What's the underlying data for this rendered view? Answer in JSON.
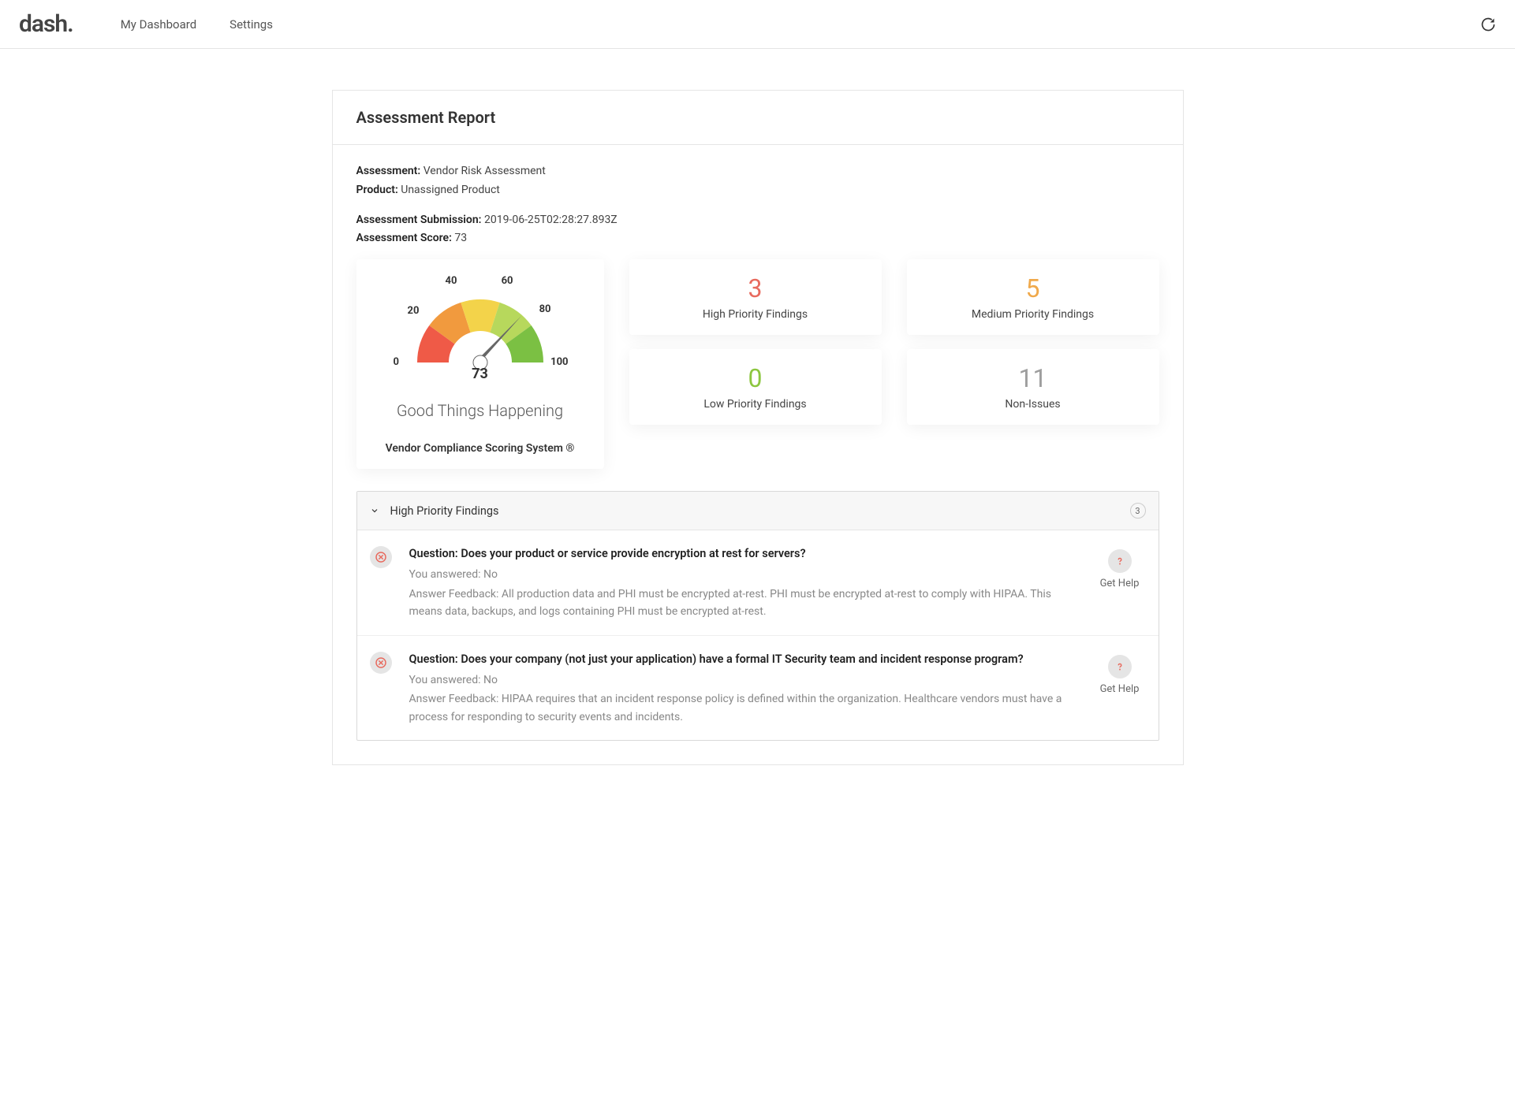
{
  "nav": {
    "logo": "dash",
    "items": [
      "My Dashboard",
      "Settings"
    ]
  },
  "report": {
    "title": "Assessment Report",
    "meta": {
      "assessment_label": "Assessment:",
      "assessment_value": "Vendor Risk Assessment",
      "product_label": "Product:",
      "product_value": "Unassigned Product",
      "submission_label": "Assessment Submission:",
      "submission_value": "2019-06-25T02:28:27.893Z",
      "score_label": "Assessment Score:",
      "score_value": "73"
    },
    "gauge": {
      "score": "73",
      "ticks": [
        "0",
        "20",
        "40",
        "60",
        "80",
        "100"
      ],
      "message": "Good Things Happening",
      "system": "Vendor Compliance Scoring System ®"
    },
    "stats": {
      "high": {
        "value": "3",
        "label": "High Priority Findings"
      },
      "medium": {
        "value": "5",
        "label": "Medium Priority Findings"
      },
      "low": {
        "value": "0",
        "label": "Low Priority Findings"
      },
      "non": {
        "value": "11",
        "label": "Non-Issues"
      }
    },
    "findings_section": {
      "title": "High Priority Findings",
      "count": "3",
      "items": [
        {
          "question_label": "Question:",
          "question": "Does your product or service provide encryption at rest for servers?",
          "answered_prefix": "You answered:",
          "answered": "No",
          "feedback_prefix": "Answer Feedback:",
          "feedback": "All production data and PHI must be encrypted at-rest. PHI must be encrypted at-rest to comply with HIPAA. This means data, backups, and logs containing PHI must be encrypted at-rest.",
          "help_label": "Get Help"
        },
        {
          "question_label": "Question:",
          "question": "Does your company (not just your application) have a formal IT Security team and incident response program?",
          "answered_prefix": "You answered:",
          "answered": "No",
          "feedback_prefix": "Answer Feedback:",
          "feedback": "HIPAA requires that an incident response policy is defined within the organization. Healthcare vendors must have a process for responding to security events and incidents.",
          "help_label": "Get Help"
        }
      ]
    }
  },
  "chart_data": {
    "type": "gauge",
    "value": 73,
    "min": 0,
    "max": 100,
    "ticks": [
      0,
      20,
      40,
      60,
      80,
      100
    ],
    "segments": [
      {
        "from": 0,
        "to": 20,
        "color": "#ef5a47"
      },
      {
        "from": 20,
        "to": 40,
        "color": "#f19a3e"
      },
      {
        "from": 40,
        "to": 60,
        "color": "#f3d34a"
      },
      {
        "from": 60,
        "to": 80,
        "color": "#b7d85c"
      },
      {
        "from": 80,
        "to": 100,
        "color": "#7bc043"
      }
    ],
    "title": "Vendor Compliance Scoring System ®",
    "subtitle": "Good Things Happening"
  }
}
